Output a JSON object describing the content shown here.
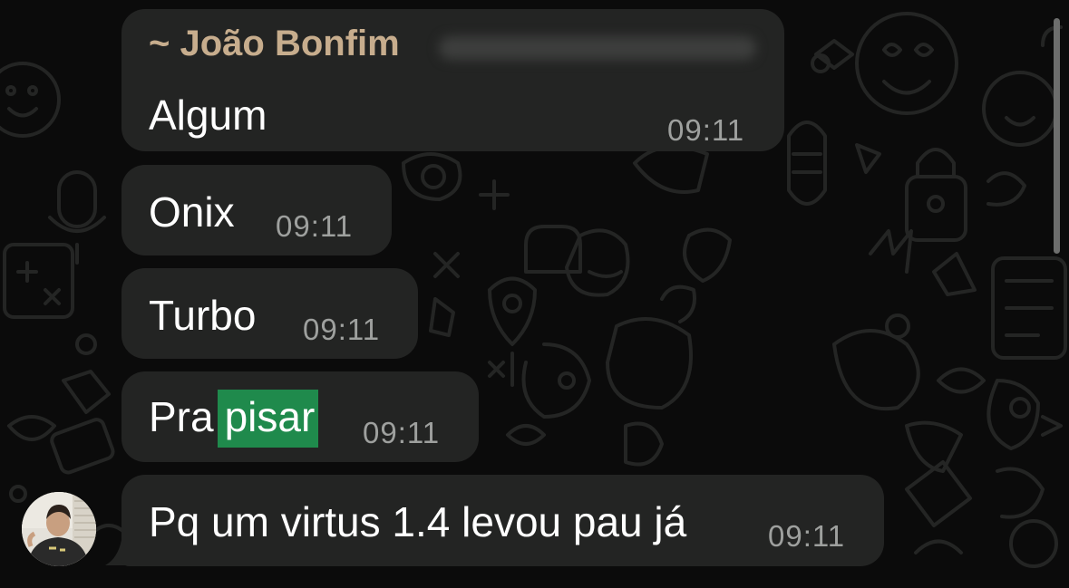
{
  "messages": [
    {
      "sender": "~ João Bonfim",
      "text": "Algum",
      "time": "09:11"
    },
    {
      "text": "Onix",
      "time": "09:11"
    },
    {
      "text": "Turbo",
      "time": "09:11"
    },
    {
      "text_before": "Pra",
      "text_highlight": "pisar",
      "time": "09:11"
    },
    {
      "text": "Pq um virtus 1.4 levou pau já",
      "time": "09:11"
    }
  ],
  "colors": {
    "background": "#0b0b0b",
    "bubble": "#232423",
    "sender_name": "#c7ad8d",
    "timestamp": "#9ea09e",
    "search_highlight": "#1f8a4c"
  },
  "icons": [
    "avatar",
    "whatsapp-doodle-wallpaper"
  ]
}
